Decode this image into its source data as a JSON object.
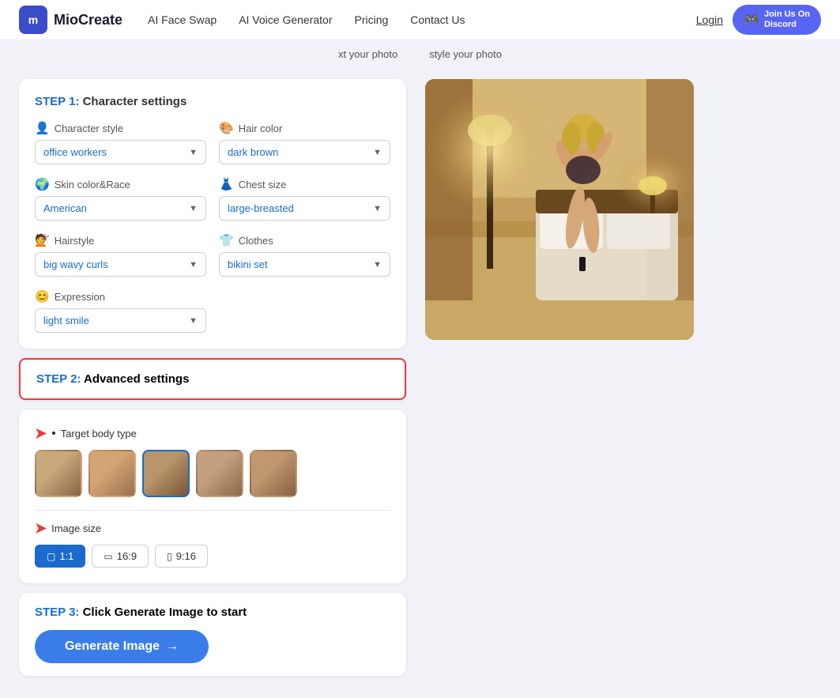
{
  "brand": {
    "logo_letters": "m",
    "logo_name": "MioCreate"
  },
  "navbar": {
    "links": [
      {
        "label": "AI Face Swap",
        "name": "nav-face-swap"
      },
      {
        "label": "AI Voice Generator",
        "name": "nav-voice"
      },
      {
        "label": "Pricing",
        "name": "nav-pricing"
      },
      {
        "label": "Contact Us",
        "name": "nav-contact"
      }
    ],
    "login_label": "Login",
    "discord_label": "Join Us On\nDiscord"
  },
  "header_scroll": {
    "text1": "xt your photo",
    "text2": "style your photo"
  },
  "step1": {
    "title_step": "STEP 1:",
    "title_desc": " Character settings",
    "character_style_label": "Character style",
    "character_style_value": "office workers",
    "hair_color_label": "Hair color",
    "hair_color_value": "dark brown",
    "skin_race_label": "Skin color&Race",
    "skin_race_value": "American",
    "chest_size_label": "Chest size",
    "chest_size_value": "large-breasted",
    "hairstyle_label": "Hairstyle",
    "hairstyle_value": "big wavy curls",
    "clothes_label": "Clothes",
    "clothes_value": "bikini set",
    "expression_label": "Expression",
    "expression_value": "light smile"
  },
  "step2": {
    "title_step": "STEP 2:",
    "title_desc": " Advanced settings",
    "body_type_label": "Target body type",
    "image_size_label": "Image size",
    "sizes": [
      {
        "label": "1:1",
        "icon": "▢",
        "active": true
      },
      {
        "label": "16:9",
        "icon": "▭",
        "active": false
      },
      {
        "label": "9:16",
        "icon": "▯",
        "active": false
      }
    ]
  },
  "step3": {
    "title_step": "STEP 3:",
    "title_desc": " Click Generate Image to start",
    "generate_btn_label": "Generate Image",
    "generate_btn_arrow": "→"
  }
}
